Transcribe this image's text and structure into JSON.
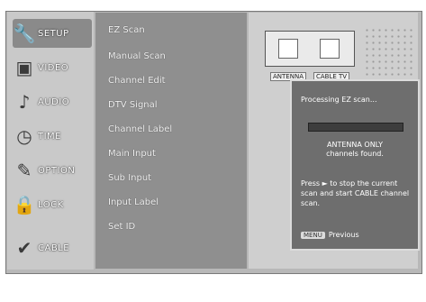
{
  "sidebar": {
    "items": [
      {
        "label": "SETUP",
        "icon": "setup-icon"
      },
      {
        "label": "VIDEO",
        "icon": "video-icon"
      },
      {
        "label": "AUDIO",
        "icon": "audio-icon"
      },
      {
        "label": "TIME",
        "icon": "time-icon"
      },
      {
        "label": "OPTION",
        "icon": "option-icon"
      },
      {
        "label": "LOCK",
        "icon": "lock-icon"
      },
      {
        "label": "CABLE",
        "icon": "cable-icon"
      }
    ]
  },
  "menu": {
    "items": [
      "EZ Scan",
      "Manual Scan",
      "Channel Edit",
      "DTV Signal",
      "Channel Label",
      "Main Input",
      "Sub Input",
      "Input Label",
      "Set ID"
    ]
  },
  "diagram": {
    "label_left": "ANTENNA",
    "label_right": "CABLE TV"
  },
  "dialog": {
    "title": "Processing EZ scan...",
    "progress": 0.0,
    "line2a": "ANTENNA ONLY",
    "line2b": "channels found.",
    "line3": "Press ► to stop the current scan and start CABLE channel scan.",
    "footer_key": "MENU",
    "footer_text": "Previous"
  },
  "colors": {
    "frame": "#b8b8b8",
    "sidebar": "#c9c9c9",
    "menu": "#8f8f8f",
    "dialog": "#6e6e6e"
  }
}
